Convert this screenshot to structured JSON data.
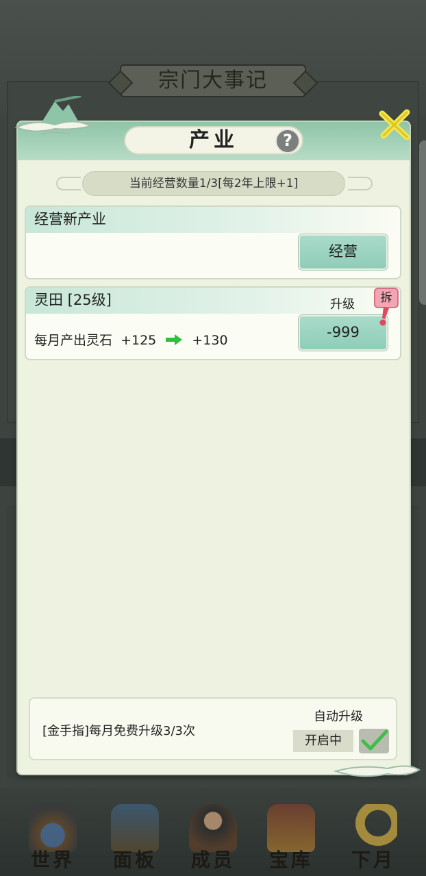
{
  "background": {
    "title": "宗门大事记"
  },
  "modal": {
    "title": "产业",
    "help_icon": "question-icon",
    "operation_count": "当前经营数量1/3[每2年上限+1]",
    "new_industry": {
      "heading": "经营新产业",
      "button_label": "经营"
    },
    "industries": [
      {
        "name": "灵田 [25级]",
        "upgrade_label": "升级",
        "output_text": "每月产出灵石",
        "output_current": "+125",
        "output_next": "+130",
        "upgrade_cost": "-999",
        "demolish_label": "拆"
      }
    ],
    "footer": {
      "free_upgrade_text": "[金手指]每月免费升级3/3次",
      "auto_upgrade_label": "自动升级",
      "status": "开启中",
      "checked": true
    }
  },
  "nav": {
    "items": [
      {
        "label": "世界",
        "icon": "world-icon"
      },
      {
        "label": "面板",
        "icon": "panel-icon"
      },
      {
        "label": "成员",
        "icon": "members-icon"
      },
      {
        "label": "宝库",
        "icon": "vault-icon"
      },
      {
        "label": "下月",
        "icon": "next-month-icon"
      }
    ]
  },
  "colors": {
    "accent_green": "#8fcdb8",
    "header_green": "#8ec5a8",
    "arrow_green": "#2fbf3f",
    "badge_pink": "#f2a6b4",
    "close_yellow": "#f5e64a"
  }
}
